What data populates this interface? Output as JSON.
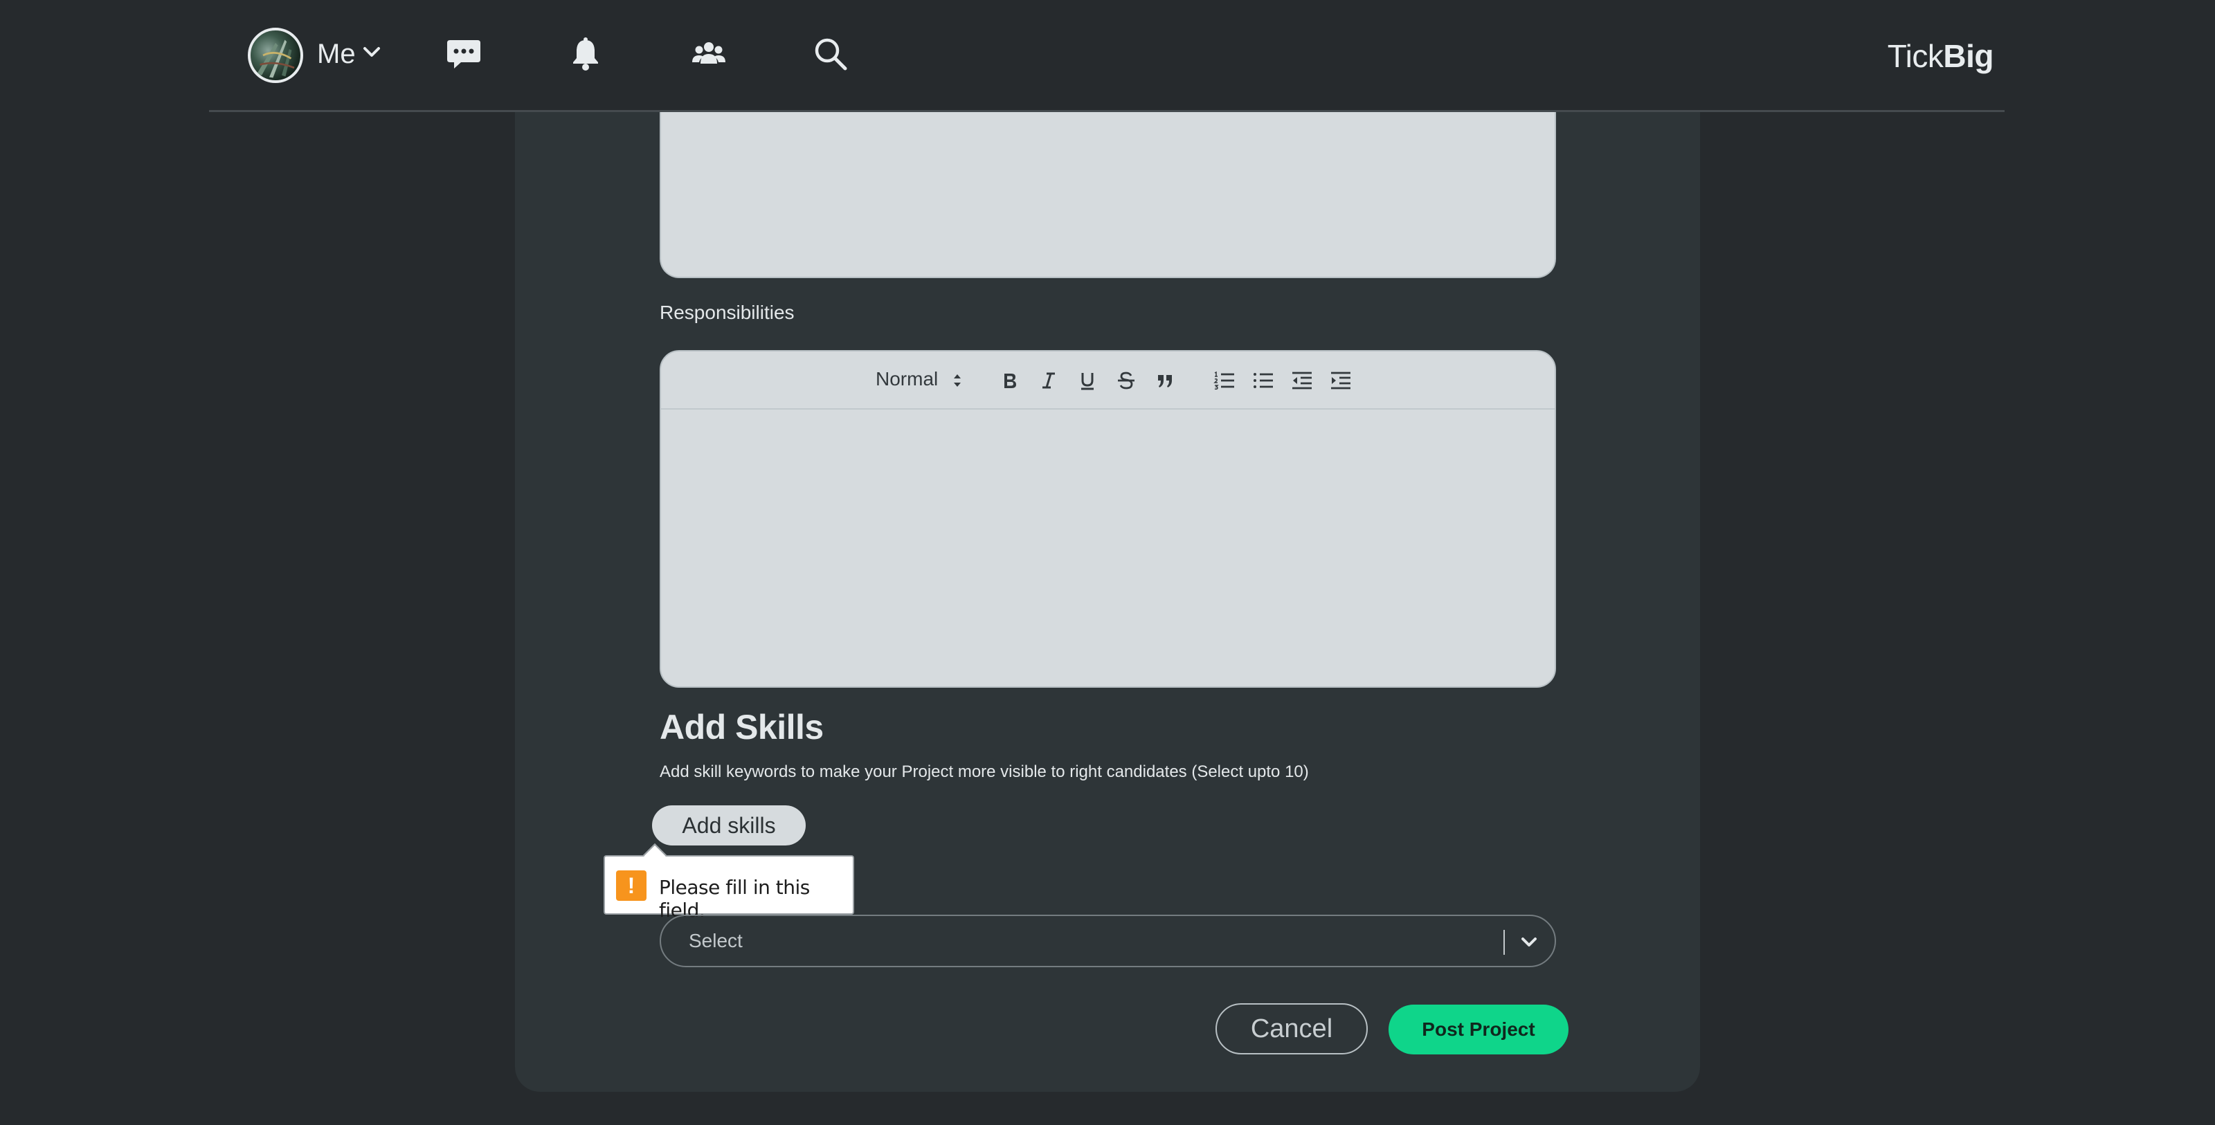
{
  "header": {
    "profile_label": "Me",
    "logo_light": "Tick",
    "logo_bold": "Big",
    "icons": [
      "chat-icon",
      "bell-icon",
      "people-icon",
      "search-icon"
    ]
  },
  "form": {
    "responsibilities_label": "Responsibilities",
    "editor_toolbar": {
      "format_value": "Normal",
      "buttons": [
        "bold",
        "italic",
        "underline",
        "strikethrough",
        "blockquote",
        "ordered-list",
        "bullet-list",
        "outdent",
        "indent"
      ]
    },
    "skills": {
      "title": "Add Skills",
      "description": "Add skill keywords to make your Project more visible to right candidates (Select upto 10)",
      "add_button": "Add skills"
    },
    "validation": {
      "message": "Please fill in this field.",
      "icon_text": "!"
    },
    "select": {
      "placeholder": "Select"
    },
    "actions": {
      "cancel": "Cancel",
      "submit": "Post Project"
    }
  },
  "colors": {
    "page_bg": "#262a2d",
    "card_bg": "#2e3538",
    "editor_bg": "#d6dbde",
    "accent": "#0fd58a",
    "warning": "#f7941d"
  }
}
